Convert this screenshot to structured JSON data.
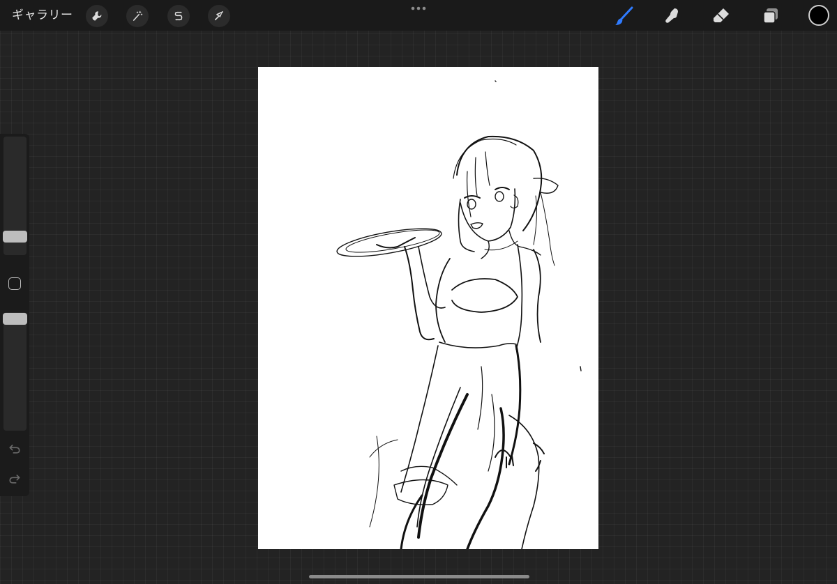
{
  "topbar": {
    "gallery_label": "ギャラリー",
    "left_tools": [
      {
        "name": "wrench-icon",
        "action": "actions"
      },
      {
        "name": "magic-wand-icon",
        "action": "adjustments"
      },
      {
        "name": "selection-s-icon",
        "action": "selection"
      },
      {
        "name": "arrow-cursor-icon",
        "action": "transform"
      }
    ],
    "right_tools": [
      {
        "name": "brush-icon",
        "action": "paint"
      },
      {
        "name": "smudge-icon",
        "action": "smudge"
      },
      {
        "name": "eraser-icon",
        "action": "erase"
      },
      {
        "name": "layers-icon",
        "action": "layers"
      }
    ],
    "brush_active_color": "#2f7bff",
    "current_color": "#000000"
  },
  "sidebar": {
    "brush_size_level": 0.22,
    "opacity_level": 1.0
  },
  "colors": {
    "canvas_bg": "#ffffff",
    "workspace_bg": "#232323",
    "toolbar_bg": "#1a1a1a"
  }
}
